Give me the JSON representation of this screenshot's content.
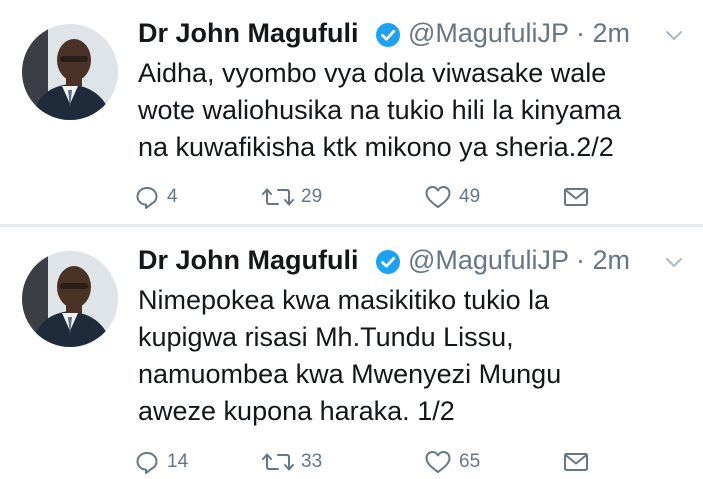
{
  "tweets": [
    {
      "author_name": "Dr John Magufuli",
      "handle_time": "@MagufuliJP · 2m",
      "lines": [
        "Aidha, vyombo vya dola viwasake wale",
        "wote waliohusika na tukio hili la kinyama",
        "na kuwafikisha ktk mikono ya sheria.2/2"
      ],
      "replies": "4",
      "retweets": "29",
      "likes": "49"
    },
    {
      "author_name": "Dr John Magufuli",
      "handle_time": "@MagufuliJP · 2m",
      "lines": [
        "Nimepokea kwa masikitiko tukio la",
        "kupigwa risasi Mh.Tundu Lissu,",
        "namuombea kwa Mwenyezi Mungu",
        "aweze kupona haraka. 1/2"
      ],
      "replies": "14",
      "retweets": "33",
      "likes": "65"
    }
  ],
  "icons": {
    "verified": "verified-badge-icon",
    "caret": "chevron-down-icon",
    "reply": "reply-icon",
    "retweet": "retweet-icon",
    "like": "heart-icon",
    "mail": "direct-message-icon"
  },
  "colors": {
    "text": "#14171a",
    "secondary": "#657786",
    "verified": "#1da1f2",
    "divider": "#e6ecf0"
  }
}
